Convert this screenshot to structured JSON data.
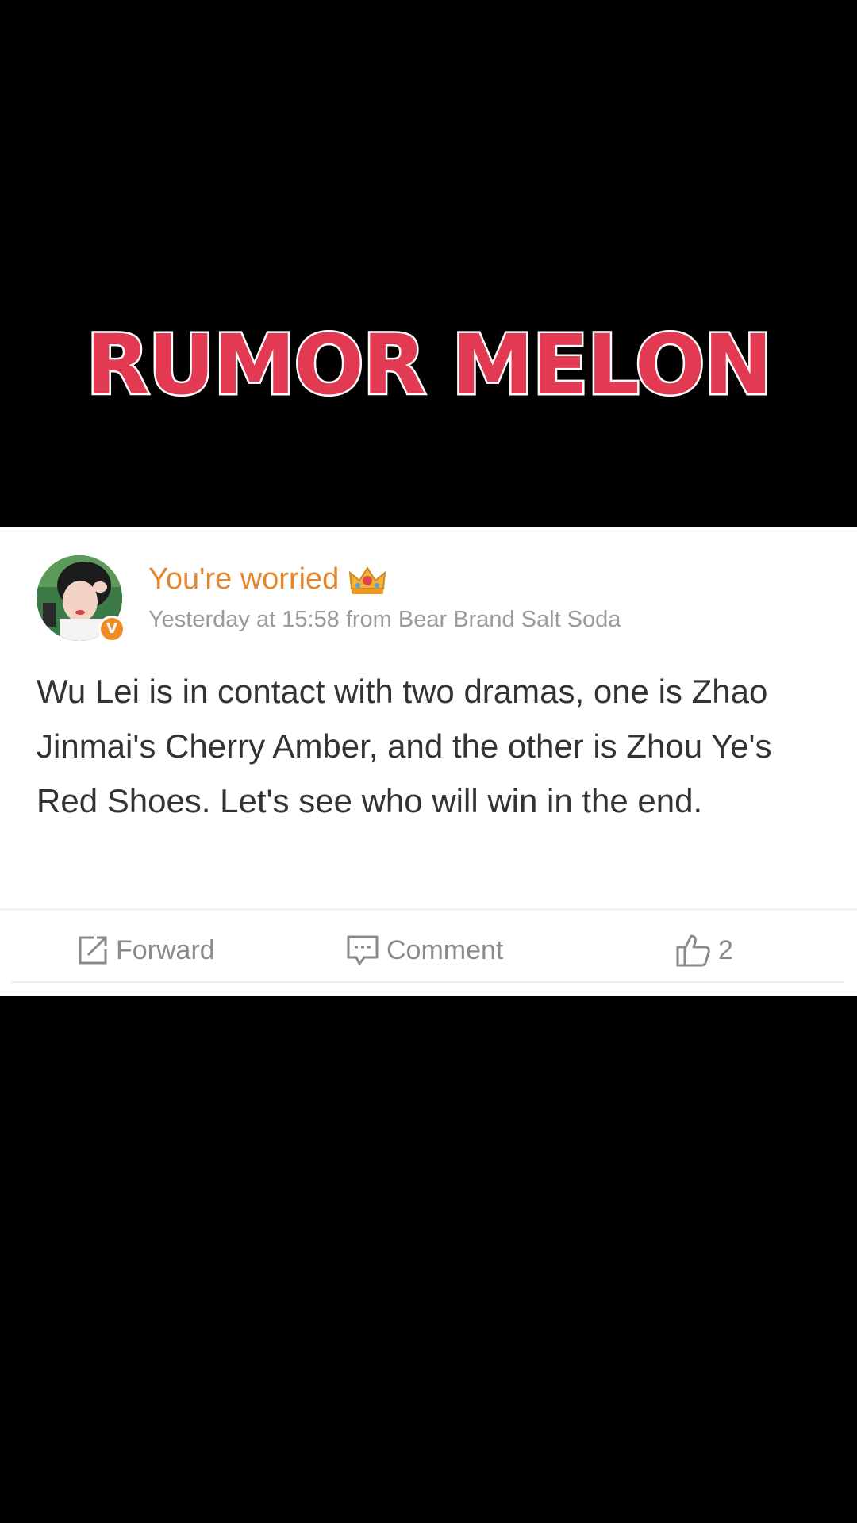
{
  "banner": {
    "title": "RUMOR MELON"
  },
  "post": {
    "author": {
      "name": "You're worried",
      "avatar": "avatar-photo",
      "badge_icon": "verified-v-icon",
      "badge_text": "V",
      "badge_color": "#f08a24",
      "title_icon": "crown-icon",
      "name_color": "#e3862e"
    },
    "meta": "Yesterday at 15:58 from Bear Brand Salt Soda",
    "body": "Wu Lei is in contact with two dramas, one is Zhao Jinmai's Cherry Amber, and the other is Zhou Ye's Red Shoes. Let's see who will win in the end.",
    "actions": {
      "forward": {
        "label": "Forward",
        "icon": "share-icon"
      },
      "comment": {
        "label": "Comment",
        "icon": "comment-icon"
      },
      "like": {
        "count": "2",
        "icon": "thumbs-up-icon"
      }
    }
  },
  "colors": {
    "banner_red": "#e23a52",
    "background": "#000000",
    "card": "#ffffff"
  }
}
